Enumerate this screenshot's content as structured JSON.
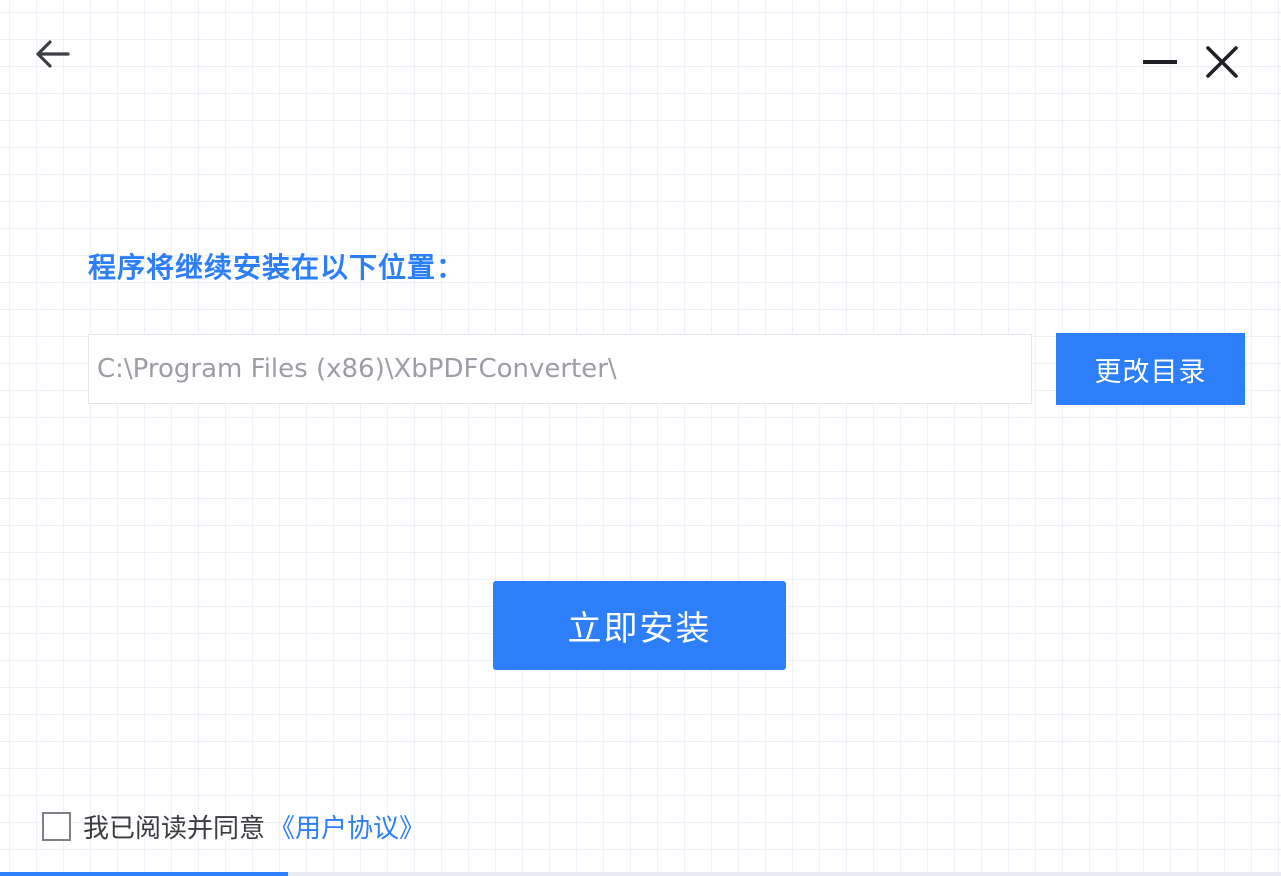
{
  "window": {
    "back_icon": "arrow-left-icon",
    "minimize_icon": "minimize-icon",
    "close_icon": "close-icon"
  },
  "install_location": {
    "title": "程序将继续安装在以下位置：",
    "path_value": "C:\\Program Files (x86)\\XbPDFConverter\\",
    "change_dir_label": "更改目录"
  },
  "actions": {
    "install_now_label": "立即安装"
  },
  "agreement": {
    "checked": false,
    "text": "我已阅读并同意",
    "link_text": "《用户协议》"
  },
  "colors": {
    "accent": "#2d7ff9",
    "text_dark": "#3a3c40",
    "input_text": "#9b9ea4",
    "grid": "#edf0f8"
  }
}
